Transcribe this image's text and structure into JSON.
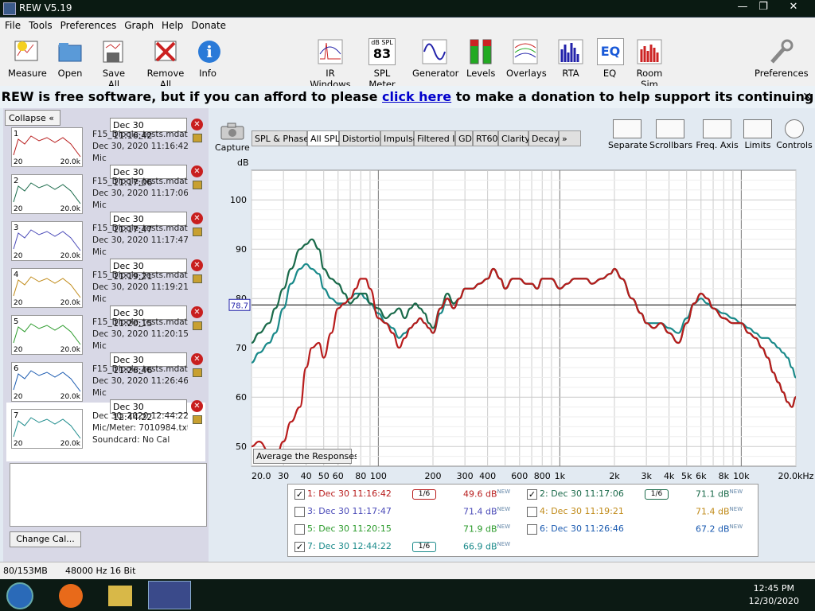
{
  "window": {
    "title": "REW V5.19",
    "minimize": "—",
    "maximize": "❐",
    "close": "✕"
  },
  "menu": [
    "File",
    "Tools",
    "Preferences",
    "Graph",
    "Help",
    "Donate"
  ],
  "toolbar": {
    "left": [
      "Measure",
      "Open",
      "Save All",
      "Remove All",
      "Info"
    ],
    "mid": [
      "IR Windows",
      "SPL Meter",
      "Generator",
      "Levels",
      "Overlays",
      "RTA",
      "EQ",
      "Room Sim"
    ],
    "spl_meter_top": "dB SPL",
    "spl_meter_value": "83",
    "eq_icon_text": "EQ",
    "right": "Preferences"
  },
  "donate": {
    "pre": "REW is free software, but if you can afford to please",
    "link": "click here",
    "post": "to make a donation to help support its continuing development",
    "close": "✕"
  },
  "sidebar": {
    "collapse": "Collapse",
    "change_cal": "Change Cal...",
    "measurements": [
      {
        "num": "1",
        "name": "Dec 30 11:16:42",
        "file": "F15_Dipole_tests.mdat",
        "date": "Dec 30, 2020 11:16:42 A",
        "mic": "Mic",
        "color": "#b81c1c"
      },
      {
        "num": "2",
        "name": "Dec 30 11:17:06",
        "file": "F15_Dipole_tests.mdat",
        "date": "Dec 30, 2020 11:17:06 A",
        "mic": "Mic",
        "color": "#1a6a4a"
      },
      {
        "num": "3",
        "name": "Dec 30 11:17:47",
        "file": "F15_Dipole_tests.mdat",
        "date": "Dec 30, 2020 11:17:47 A",
        "mic": "Mic",
        "color": "#4a4ab8"
      },
      {
        "num": "4",
        "name": "Dec 30 11:19:21",
        "file": "F15_Dipole_tests.mdat",
        "date": "Dec 30, 2020 11:19:21 A",
        "mic": "Mic",
        "color": "#c08a18"
      },
      {
        "num": "5",
        "name": "Dec 30 11:20:15",
        "file": "F15_Dipole_tests.mdat",
        "date": "Dec 30, 2020 11:20:15 A",
        "mic": "Mic",
        "color": "#2a9a2a"
      },
      {
        "num": "6",
        "name": "Dec 30 11:26:46",
        "file": "F15_Dipole_tests.mdat",
        "date": "Dec 30, 2020 11:26:46 A",
        "mic": "Mic",
        "color": "#1a5ab0"
      },
      {
        "num": "7",
        "name": "Dec 30 12:44:22",
        "file": "Dec 30, 2020 12:44:22 P",
        "date": "Mic/Meter: 7010984.txt",
        "mic": "Soundcard: No Cal",
        "color": "#1a8a8a"
      }
    ],
    "thumb_x_min": "20",
    "thumb_x_max": "20.0k"
  },
  "graph": {
    "capture": "Capture",
    "tabs": [
      "SPL & Phase",
      "All SPL",
      "Distortion",
      "Impulse",
      "Filtered IR",
      "GD",
      "RT60",
      "Clarity",
      "Decay",
      "»"
    ],
    "selected_tab": "All SPL",
    "right_tools": [
      "Separate",
      "Scrollbars",
      "Freq. Axis",
      "Limits",
      "Controls"
    ],
    "db_unit": "dB",
    "avg_button": "Average the Responses"
  },
  "legend": [
    {
      "label": "1: Dec 30 11:16:42",
      "smooth": "1/6",
      "value": "49.6 dB",
      "checked": true,
      "color": "#b81c1c"
    },
    {
      "label": "2: Dec 30 11:17:06",
      "smooth": "1/6",
      "value": "71.1 dB",
      "checked": true,
      "color": "#1a6a4a"
    },
    {
      "label": "3: Dec 30 11:17:47",
      "smooth": "",
      "value": "71.4 dB",
      "checked": false,
      "color": "#4a4ab8"
    },
    {
      "label": "4: Dec 30 11:19:21",
      "smooth": "",
      "value": "71.4 dB",
      "checked": false,
      "color": "#c08a18"
    },
    {
      "label": "5: Dec 30 11:20:15",
      "smooth": "",
      "value": "71.9 dB",
      "checked": false,
      "color": "#2a9a2a"
    },
    {
      "label": "6: Dec 30 11:26:46",
      "smooth": "",
      "value": "67.2 dB",
      "checked": false,
      "color": "#1a5ab0"
    },
    {
      "label": "7: Dec 30 12:44:22",
      "smooth": "1/6",
      "value": "66.9 dB",
      "checked": true,
      "color": "#1a8a8a"
    }
  ],
  "legend_new": "NEW",
  "status": {
    "mem": "80/153MB",
    "rate": "48000 Hz",
    "bits": "16 Bit"
  },
  "taskbar": {
    "time": "12:45 PM",
    "date": "12/30/2020"
  },
  "chart_data": {
    "type": "line",
    "ylabel": "dB",
    "xscale": "log",
    "xlim": [
      20,
      20000
    ],
    "ylim": [
      46,
      106
    ],
    "xticks": [
      "20.0",
      "30",
      "40",
      "50",
      "60",
      "80",
      "100",
      "200",
      "300",
      "400",
      "600",
      "800",
      "1k",
      "2k",
      "3k",
      "4k",
      "5k",
      "6k",
      "8k",
      "10k",
      "20.0kHz"
    ],
    "xtick_values": [
      20,
      30,
      40,
      50,
      60,
      80,
      100,
      200,
      300,
      400,
      600,
      800,
      1000,
      2000,
      3000,
      4000,
      5000,
      6000,
      8000,
      10000,
      20000
    ],
    "yticks": [
      50,
      60,
      70,
      80,
      90,
      100
    ],
    "cursor_level": "78.7",
    "grid": true,
    "series": [
      {
        "name": "1: Dec 30 11:16:42",
        "color": "#b81c1c",
        "x": [
          20,
          22,
          25,
          27,
          30,
          33,
          37,
          40,
          43,
          47,
          50,
          55,
          60,
          65,
          70,
          75,
          80,
          85,
          90,
          100,
          110,
          120,
          130,
          140,
          150,
          160,
          170,
          180,
          190,
          200,
          220,
          240,
          260,
          280,
          300,
          330,
          360,
          400,
          430,
          470,
          500,
          550,
          600,
          650,
          700,
          750,
          800,
          900,
          1000,
          1100,
          1200,
          1300,
          1400,
          1500,
          1700,
          1900,
          2000,
          2200,
          2500,
          2800,
          3000,
          3300,
          3600,
          4000,
          4500,
          5000,
          5500,
          6000,
          6500,
          7000,
          8000,
          9000,
          10000,
          11000,
          12000,
          13000,
          14000,
          15000,
          16000,
          17000,
          18000,
          19000,
          20000
        ],
        "y": [
          50,
          51,
          49,
          47,
          51,
          55,
          58,
          66,
          70,
          71,
          68,
          73,
          78,
          79,
          80,
          82,
          84,
          84,
          82,
          76,
          75,
          73,
          70,
          72,
          74,
          75,
          76,
          75,
          74,
          73,
          78,
          80,
          78,
          80,
          82,
          82,
          83,
          84,
          86,
          84,
          82,
          84,
          84,
          83,
          83,
          82,
          84,
          84,
          82,
          83,
          84,
          84,
          84,
          83,
          84,
          85,
          86,
          84,
          80,
          77,
          75,
          74,
          75,
          73,
          71,
          75,
          79,
          81,
          80,
          78,
          76,
          75,
          75,
          73,
          72,
          70,
          68,
          65,
          63,
          61,
          59,
          58,
          60
        ]
      },
      {
        "name": "2: Dec 30 11:17:06",
        "color": "#1a6a4a",
        "x": [
          20,
          22,
          25,
          27,
          30,
          33,
          37,
          40,
          43,
          47,
          50,
          55,
          60,
          65,
          70,
          75,
          80,
          85,
          90,
          100,
          110,
          120,
          130,
          140,
          150,
          160,
          170,
          180,
          190,
          200,
          220,
          240,
          260,
          280,
          300,
          330,
          360,
          400,
          430,
          470,
          500,
          550,
          600,
          650,
          700,
          750,
          800,
          900,
          1000,
          1100,
          1200,
          1300,
          1400,
          1500,
          1700,
          1900,
          2000,
          2200,
          2500,
          2800,
          3000,
          3300,
          3600,
          4000,
          4500,
          5000,
          5500,
          6000,
          6500,
          7000,
          8000,
          9000,
          10000,
          11000,
          12000,
          13000,
          14000,
          15000,
          16000,
          17000,
          18000,
          19000,
          20000
        ],
        "y": [
          71,
          73,
          75,
          78,
          82,
          86,
          90,
          91,
          92,
          90,
          86,
          84,
          83,
          81,
          79,
          80,
          81,
          81,
          79,
          78,
          76,
          77,
          78,
          76,
          78,
          79,
          78,
          77,
          75,
          74,
          78,
          81,
          79,
          80,
          82,
          82,
          83,
          84,
          86,
          84,
          82,
          84,
          84,
          83,
          83,
          82,
          84,
          84,
          82,
          83,
          84,
          84,
          84,
          83,
          84,
          85,
          86,
          84,
          80,
          77,
          75,
          74,
          75,
          73,
          71,
          75,
          79,
          81,
          80,
          78,
          76,
          75,
          75,
          73,
          72,
          70,
          68,
          65,
          63,
          61,
          59,
          58,
          60
        ]
      },
      {
        "name": "7: Dec 30 12:44:22",
        "color": "#1a8a8a",
        "x": [
          20,
          22,
          25,
          27,
          30,
          33,
          37,
          40,
          43,
          47,
          50,
          55,
          60,
          65,
          70,
          75,
          80,
          85,
          90,
          100,
          110,
          120,
          130,
          140,
          150,
          160,
          170,
          180,
          190,
          200,
          220,
          240,
          260,
          280,
          300,
          330,
          360,
          400,
          430,
          470,
          500,
          550,
          600,
          650,
          700,
          750,
          800,
          900,
          1000,
          1100,
          1200,
          1300,
          1400,
          1500,
          1700,
          1900,
          2000,
          2200,
          2500,
          2800,
          3000,
          3300,
          3600,
          4000,
          4500,
          5000,
          5500,
          6000,
          6500,
          7000,
          8000,
          9000,
          10000,
          11000,
          12000,
          13000,
          14000,
          15000,
          16000,
          17000,
          18000,
          19000,
          20000
        ],
        "y": [
          67,
          69,
          71,
          73,
          78,
          83,
          86,
          87,
          86,
          85,
          82,
          80,
          79,
          79,
          80,
          81,
          81,
          80,
          79,
          77,
          75,
          74,
          72,
          73,
          74,
          75,
          76,
          75,
          74,
          73,
          77,
          80,
          78,
          80,
          82,
          82,
          83,
          84,
          86,
          84,
          82,
          84,
          84,
          83,
          83,
          82,
          84,
          84,
          82,
          83,
          84,
          84,
          84,
          83,
          84,
          85,
          86,
          84,
          80,
          77,
          75,
          75,
          75,
          74,
          73,
          76,
          79,
          80,
          79,
          78,
          77,
          76,
          75,
          74,
          73,
          72,
          72,
          71,
          70,
          69,
          68,
          66,
          64
        ]
      }
    ]
  }
}
